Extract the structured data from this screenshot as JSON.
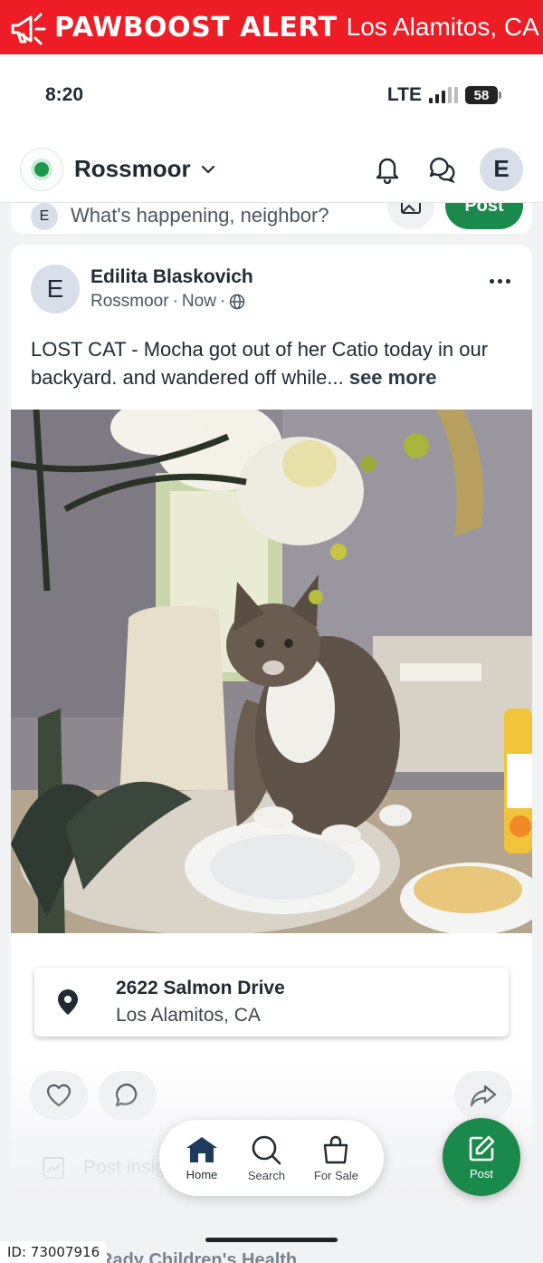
{
  "alert_banner": {
    "brand": "PAWBOOST ALERT",
    "location": "Los Alamitos, CA",
    "icon": "megaphone-icon",
    "color": "#ee1c24"
  },
  "status_bar": {
    "time": "8:20",
    "network": "LTE",
    "battery": "58"
  },
  "header": {
    "neighborhood": "Rossmoor",
    "avatar_initial": "E"
  },
  "composer": {
    "avatar_initial": "E",
    "placeholder": "What's happening, neighbor?",
    "post_label": "Post"
  },
  "post": {
    "author_initial": "E",
    "author": "Edilita Blaskovich",
    "neighborhood": "Rossmoor",
    "time": "Now",
    "text": "LOST CAT - Mocha got out of her Catio today in our backyard.  and wandered off while...",
    "see_more": "see more",
    "image_alt": "tabby-cat-on-table-photo",
    "location": {
      "street": "2622 Salmon Drive",
      "city": "Los Alamitos, CA"
    },
    "insights_label": "Post insights"
  },
  "bottom_nav": {
    "items": [
      {
        "label": "Home",
        "icon": "home-icon",
        "active": true
      },
      {
        "label": "Search",
        "icon": "search-icon",
        "active": false
      },
      {
        "label": "For Sale",
        "icon": "shopping-bag-icon",
        "active": false
      }
    ],
    "post_label": "Post"
  },
  "next_post_title": "Rady Children's Health",
  "id_tag": "ID: 73007916",
  "colors": {
    "accent_green": "#1a8a4a",
    "banner_red": "#ee1c24"
  }
}
